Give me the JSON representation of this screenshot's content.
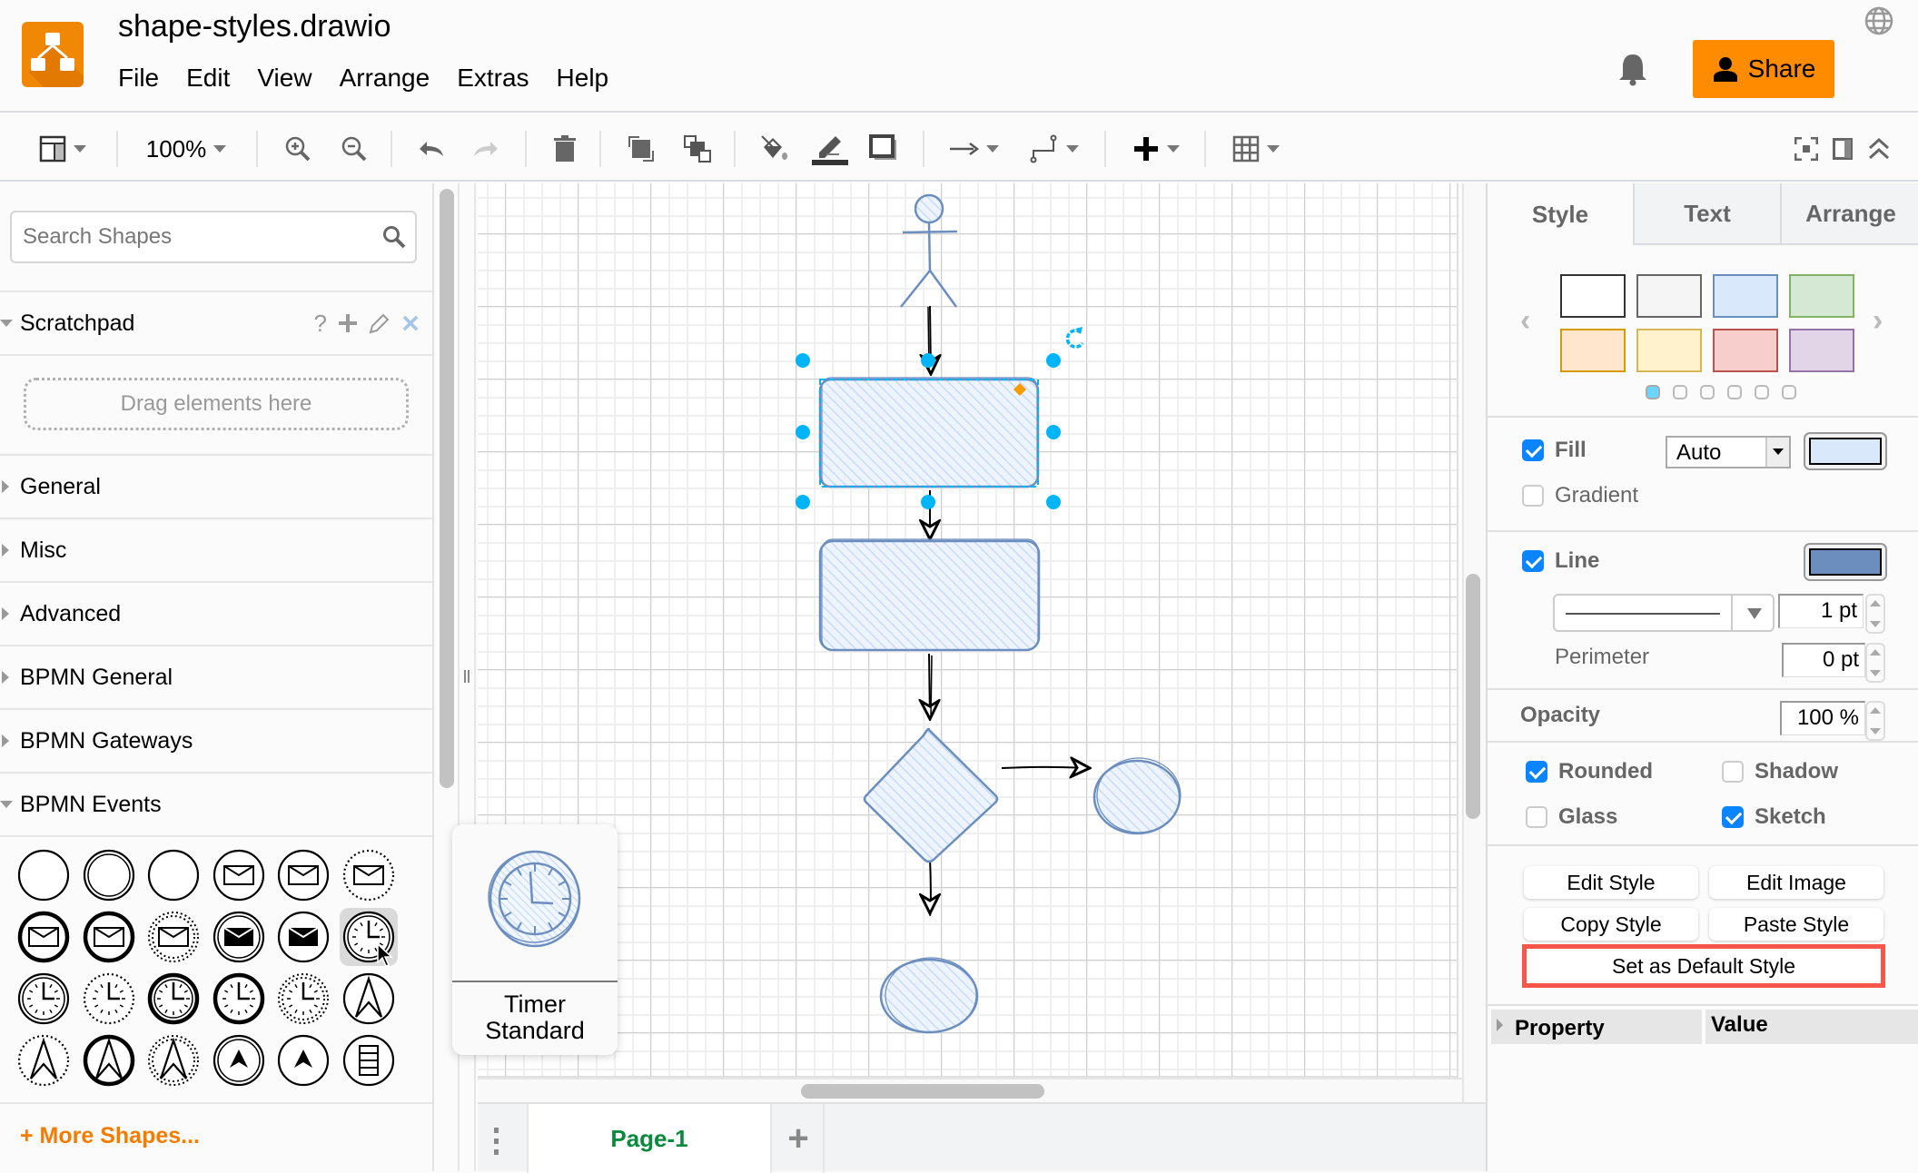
{
  "app": {
    "title": "shape-styles.drawio",
    "brand_color": "#f08705"
  },
  "menu": [
    "File",
    "Edit",
    "View",
    "Arrange",
    "Extras",
    "Help"
  ],
  "header": {
    "share_label": "Share",
    "share_color": "#ff8c00"
  },
  "toolbar": {
    "zoom": "100%",
    "icons": [
      "format-panel-icon",
      "zoom-in-icon",
      "zoom-out-icon",
      "undo-icon",
      "redo-icon",
      "delete-icon",
      "to-front-icon",
      "to-back-icon",
      "fill-color-icon",
      "line-color-icon",
      "shadow-icon",
      "connection-icon",
      "waypoints-icon",
      "insert-icon",
      "table-icon",
      "fullscreen-icon",
      "toggle-panel-icon",
      "collapse-icon"
    ]
  },
  "sidebar": {
    "search_placeholder": "Search Shapes",
    "scratchpad": {
      "label": "Scratchpad",
      "help": "?",
      "drop_hint": "Drag elements here"
    },
    "sections": [
      {
        "label": "General",
        "expanded": false
      },
      {
        "label": "Misc",
        "expanded": false
      },
      {
        "label": "Advanced",
        "expanded": false
      },
      {
        "label": "BPMN General",
        "expanded": false
      },
      {
        "label": "BPMN Gateways",
        "expanded": false
      },
      {
        "label": "BPMN Events",
        "expanded": true
      }
    ],
    "bpmn_events": [
      "start-event",
      "interrupting-event",
      "end-event-thin",
      "message-start",
      "message-intermediate",
      "message-noninterrupting",
      "message-boundary",
      "message-end-thin",
      "message-boundary-noninterrupting",
      "message-throw",
      "message-end",
      "timer-start",
      "timer-intermediate",
      "timer-noninterrupting",
      "timer-boundary",
      "timer-boundary-thick",
      "timer-boundary-noninterrupting",
      "escalation-start",
      "escalation-noninterrupting",
      "escalation-boundary",
      "escalation-boundary-noninterrupting",
      "escalation-throw",
      "escalation-end",
      "conditional-start"
    ],
    "hovered_shape_index": 11,
    "more_shapes_label": "More Shapes..."
  },
  "tooltip": {
    "label": "Timer Standard"
  },
  "pages": {
    "tabs": [
      "Page-1"
    ],
    "active": "Page-1",
    "add_label": "+"
  },
  "format_panel": {
    "tabs": [
      "Style",
      "Text",
      "Arrange"
    ],
    "active_tab": "Style",
    "swatches": [
      {
        "fill": "#ffffff",
        "stroke": "#333333"
      },
      {
        "fill": "#f5f5f5",
        "stroke": "#666666"
      },
      {
        "fill": "#dae8fc",
        "stroke": "#6c8ebf"
      },
      {
        "fill": "#d5e8d4",
        "stroke": "#82b366"
      },
      {
        "fill": "#ffe6cc",
        "stroke": "#d79b00"
      },
      {
        "fill": "#fff2cc",
        "stroke": "#d6b656"
      },
      {
        "fill": "#f8cecc",
        "stroke": "#b85450"
      },
      {
        "fill": "#e1d5e7",
        "stroke": "#9673a6"
      }
    ],
    "swatch_pages": 6,
    "swatch_page_active": 0,
    "fill": {
      "label": "Fill",
      "checked": true,
      "mode": "Auto",
      "color": "#dae8fc"
    },
    "gradient": {
      "label": "Gradient",
      "checked": false
    },
    "line": {
      "label": "Line",
      "checked": true,
      "color": "#6c8ebf",
      "width": "1 pt"
    },
    "perimeter": {
      "label": "Perimeter",
      "value": "0 pt"
    },
    "opacity": {
      "label": "Opacity",
      "value": "100 %"
    },
    "options": [
      {
        "label": "Rounded",
        "checked": true
      },
      {
        "label": "Shadow",
        "checked": false
      },
      {
        "label": "Glass",
        "checked": false
      },
      {
        "label": "Sketch",
        "checked": true
      }
    ],
    "buttons": {
      "edit_style": "Edit Style",
      "edit_image": "Edit Image",
      "copy_style": "Copy Style",
      "paste_style": "Paste Style",
      "set_default": "Set as Default Style"
    },
    "property_table": {
      "col1": "Property",
      "col2": "Value"
    }
  },
  "diagram": {
    "shape_fill": "#dae8fc",
    "shape_stroke": "#6c8ebf",
    "selection_color": "#00b5f7",
    "nodes": [
      "actor",
      "process-selected",
      "process",
      "decision",
      "end-right",
      "end-bottom"
    ]
  }
}
